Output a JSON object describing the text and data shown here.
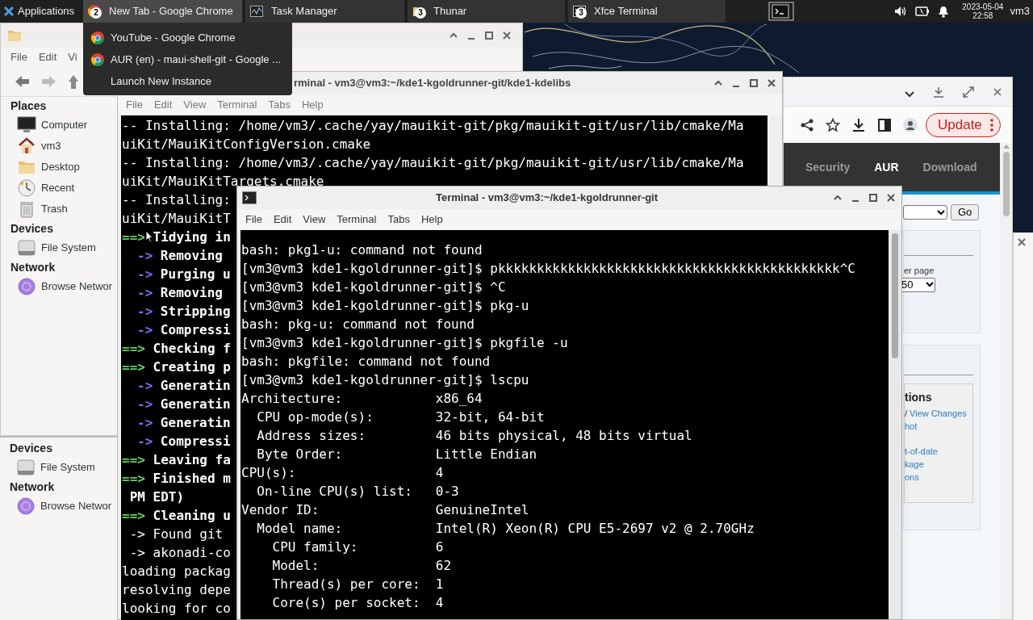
{
  "taskbar": {
    "apps_label": "Applications",
    "tasks": [
      {
        "label": "New Tab - Google Chrome",
        "kind": "browser",
        "count": "2",
        "selected": true
      },
      {
        "label": "Task Manager",
        "kind": "monitor",
        "selected": false
      },
      {
        "label": "Thunar",
        "kind": "files",
        "count": "3",
        "selected": false
      },
      {
        "label": "Xfce Terminal",
        "kind": "terminal",
        "count": "3",
        "selected": false
      }
    ],
    "date": "2023-05-04",
    "time": "22:58",
    "user": "vm3"
  },
  "task_menu": [
    {
      "label": "YouTube - Google Chrome",
      "kind": "window"
    },
    {
      "label": "AUR (en) - maui-shell-git - Google ...",
      "kind": "window"
    },
    {
      "label": "Launch New Instance",
      "kind": "action"
    }
  ],
  "file_manager": {
    "menu": [
      "File",
      "Edit",
      "Vi"
    ],
    "sections": [
      {
        "title": "Places",
        "items": [
          {
            "label": "Computer",
            "kind": "computer"
          },
          {
            "label": "vm3",
            "kind": "home"
          },
          {
            "label": "Desktop",
            "kind": "folder"
          },
          {
            "label": "Recent",
            "kind": "recent"
          },
          {
            "label": "Trash",
            "kind": "trash"
          }
        ]
      },
      {
        "title": "Devices",
        "items": [
          {
            "label": "File System",
            "kind": "drive"
          }
        ]
      },
      {
        "title": "Network",
        "items": [
          {
            "label": "Browse Networ",
            "kind": "network"
          }
        ]
      }
    ]
  },
  "file_manager_lower": {
    "sections": [
      {
        "title": "Devices",
        "items": [
          {
            "label": "File System",
            "kind": "drive"
          }
        ]
      },
      {
        "title": "Network",
        "items": [
          {
            "label": "Browse Networ",
            "kind": "network"
          }
        ]
      }
    ]
  },
  "back_terminal": {
    "title": "rminal - vm3@vm3:~/kde1-kgoldrunner-git/kde1-kdelibs",
    "menu": [
      "File",
      "Edit",
      "View",
      "Terminal",
      "Tabs",
      "Help"
    ],
    "lines": [
      {
        "kind": "plain",
        "text": "-- Installing: /home/vm3/.cache/yay/mauikit-git/pkg/mauikit-git/usr/lib/cmake/Ma"
      },
      {
        "kind": "plain",
        "text": "uiKit/MauiKitConfigVersion.cmake"
      },
      {
        "kind": "plain",
        "text": "-- Installing: /home/vm3/.cache/yay/mauikit-git/pkg/mauikit-git/usr/lib/cmake/Ma"
      },
      {
        "kind": "plain",
        "text": "uiKit/MauiKitTargets.cmake"
      },
      {
        "kind": "plain",
        "text": "-- Installing:"
      },
      {
        "kind": "plain",
        "text": "uiKit/MauiKitT"
      },
      {
        "kind": "heading",
        "marker": "==>",
        "text": "Tidying in"
      },
      {
        "kind": "step",
        "marker": "->",
        "text": "Removing"
      },
      {
        "kind": "step",
        "marker": "->",
        "text": "Purging u"
      },
      {
        "kind": "step",
        "marker": "->",
        "text": "Removing"
      },
      {
        "kind": "step",
        "marker": "->",
        "text": "Stripping"
      },
      {
        "kind": "step",
        "marker": "->",
        "text": "Compressi"
      },
      {
        "kind": "heading",
        "marker": "==>",
        "text": "Checking f"
      },
      {
        "kind": "heading",
        "marker": "==>",
        "text": "Creating p"
      },
      {
        "kind": "step",
        "marker": "->",
        "text": "Generatin"
      },
      {
        "kind": "step",
        "marker": "->",
        "text": "Generatin"
      },
      {
        "kind": "step",
        "marker": "->",
        "text": "Generatin"
      },
      {
        "kind": "step",
        "marker": "->",
        "text": "Compressi"
      },
      {
        "kind": "heading",
        "marker": "==>",
        "text": "Leaving fa"
      },
      {
        "kind": "heading",
        "marker": "==>",
        "text": "Finished m"
      },
      {
        "kind": "continued",
        "text": " PM EDT)"
      },
      {
        "kind": "heading",
        "marker": "==>",
        "text": "Cleaning u"
      },
      {
        "kind": "plain",
        "text": " -> Found git"
      },
      {
        "kind": "plain",
        "text": " -> akonadi-co"
      },
      {
        "kind": "plain",
        "text": "loading packag"
      },
      {
        "kind": "plain",
        "text": "resolving depe"
      },
      {
        "kind": "plain",
        "text": "looking for co"
      }
    ]
  },
  "front_terminal": {
    "title": "Terminal - vm3@vm3:~/kde1-kgoldrunner-git",
    "menu": [
      "File",
      "Edit",
      "View",
      "Terminal",
      "Tabs",
      "Help"
    ],
    "lines": [
      "bash: pkg1-u: command not found",
      "[vm3@vm3 kde1-kgoldrunner-git]$ pkkkkkkkkkkkkkkkkkkkkkkkkkkkkkkkkkkkkkkkkkkkk^C",
      "[vm3@vm3 kde1-kgoldrunner-git]$ ^C",
      "[vm3@vm3 kde1-kgoldrunner-git]$ pkg-u",
      "bash: pkg-u: command not found",
      "[vm3@vm3 kde1-kgoldrunner-git]$ pkgfile -u",
      "bash: pkgfile: command not found",
      "[vm3@vm3 kde1-kgoldrunner-git]$ lscpu",
      "Architecture:            x86_64",
      "  CPU op-mode(s):        32-bit, 64-bit",
      "  Address sizes:         46 bits physical, 48 bits virtual",
      "  Byte Order:            Little Endian",
      "CPU(s):                  4",
      "  On-line CPU(s) list:   0-3",
      "Vendor ID:               GenuineIntel",
      "  Model name:            Intel(R) Xeon(R) CPU E5-2697 v2 @ 2.70GHz",
      "    CPU family:          6",
      "    Model:               62",
      "    Thread(s) per core:  1",
      "    Core(s) per socket:  4"
    ]
  },
  "browser": {
    "update_label": "Update",
    "nav": [
      {
        "label": "Security",
        "selected": false
      },
      {
        "label": "AUR",
        "selected": true
      },
      {
        "label": "Download",
        "selected": false
      }
    ],
    "go_label": "Go",
    "per_page_label": "er page",
    "per_page_value": "50",
    "actions_title": "tions",
    "action_links": [
      {
        "prefix": "/",
        "link": "View Changes"
      },
      {
        "link": "hot"
      },
      {
        "link": "t-of-date"
      },
      {
        "link": "kage"
      },
      {
        "link": "ons"
      }
    ]
  }
}
